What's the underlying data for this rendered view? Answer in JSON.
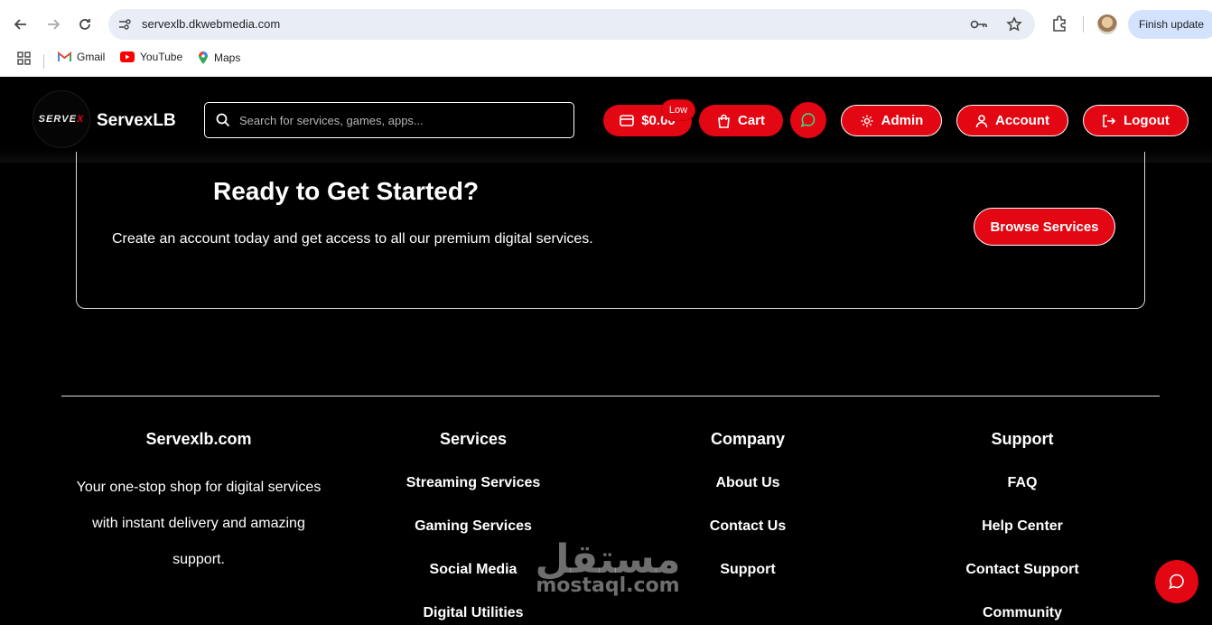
{
  "browser": {
    "url": "servexlb.dkwebmedia.com",
    "finish_update": "Finish update",
    "bookmarks": [
      {
        "label": "Gmail",
        "icon": "gmail-icon"
      },
      {
        "label": "YouTube",
        "icon": "youtube-icon"
      },
      {
        "label": "Maps",
        "icon": "maps-icon"
      }
    ]
  },
  "header": {
    "logo_text_a": "SERVE",
    "logo_text_b": "X",
    "brand": "ServexLB",
    "search_placeholder": "Search for services, games, apps...",
    "wallet_balance": "$0.00",
    "wallet_badge": "Low",
    "cart_label": "Cart",
    "admin_label": "Admin",
    "account_label": "Account",
    "logout_label": "Logout"
  },
  "cta": {
    "title": "Ready to Get Started?",
    "description": "Create an account today and get access to all our premium digital services.",
    "button": "Browse Services"
  },
  "footer": {
    "about": {
      "title": "Servexlb.com",
      "text_lines": [
        "Your one-stop shop for digital services",
        "with instant delivery and amazing",
        "support."
      ]
    },
    "services": {
      "title": "Services",
      "links": [
        "Streaming Services",
        "Gaming Services",
        "Social Media",
        "Digital Utilities"
      ]
    },
    "company": {
      "title": "Company",
      "links": [
        "About Us",
        "Contact Us",
        "Support"
      ]
    },
    "support": {
      "title": "Support",
      "links": [
        "FAQ",
        "Help Center",
        "Contact Support",
        "Community"
      ]
    }
  },
  "watermark": {
    "arabic": "مستقل",
    "latin": "mostaql.com"
  },
  "colors": {
    "accent": "#e30613",
    "background": "#000000",
    "text": "#ffffff"
  }
}
